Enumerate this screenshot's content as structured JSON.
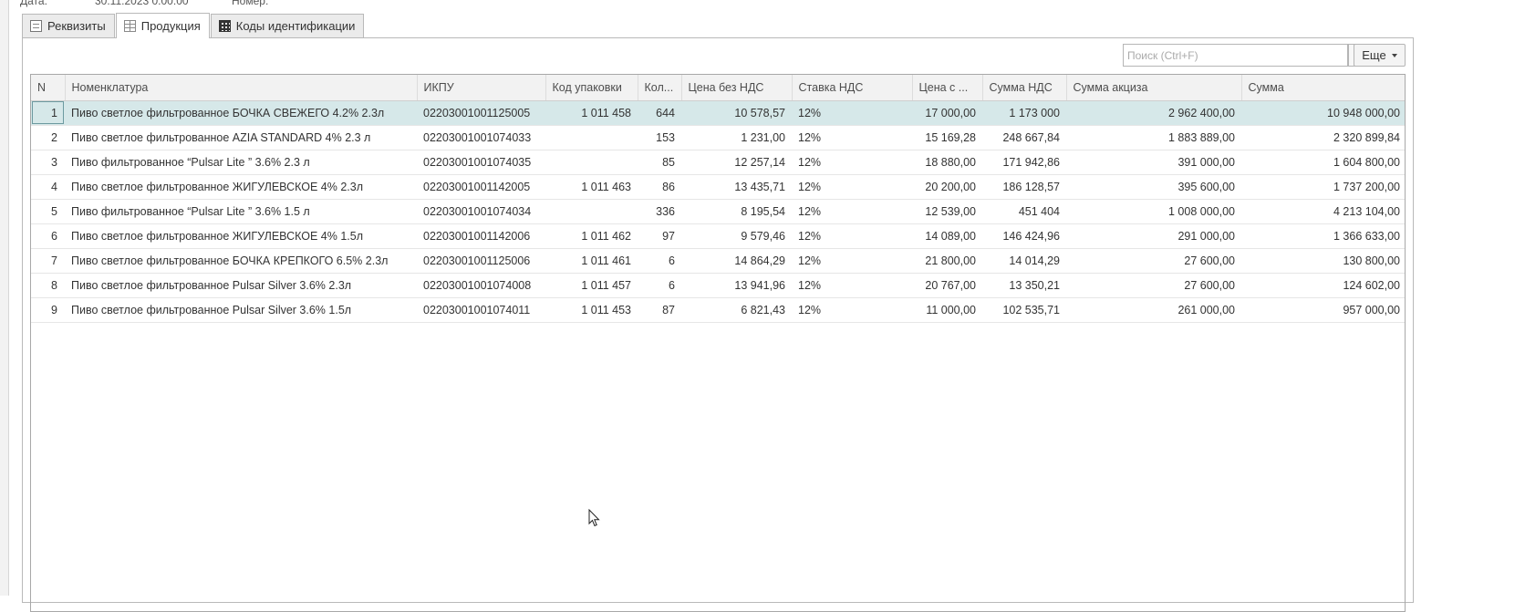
{
  "header_cut": {
    "left_label": "Дата:",
    "date_value": "30.11.2023 0:00:00",
    "number_label": "Номер:"
  },
  "tabs": [
    {
      "label": "Реквизиты",
      "icon": "document-icon",
      "active": false
    },
    {
      "label": "Продукция",
      "icon": "table-icon",
      "active": true
    },
    {
      "label": "Коды идентификации",
      "icon": "qr-code-icon",
      "active": false
    }
  ],
  "toolbar": {
    "search_placeholder": "Поиск (Ctrl+F)",
    "clear_label": "×",
    "more_label": "Еще"
  },
  "columns": [
    "N",
    "Номенклатура",
    "ИКПУ",
    "Код упаковки",
    "Кол...",
    "Цена без НДС",
    "Ставка НДС",
    "Цена с ...",
    "Сумма НДС",
    "Сумма акциза",
    "Сумма"
  ],
  "rows": [
    [
      "1",
      "Пиво светлое фильтрованное БОЧКА СВЕЖЕГО 4.2% 2.3л",
      "02203001001125005",
      "1 011 458",
      "644",
      "10 578,57",
      "12%",
      "17 000,00",
      "1 173 000",
      "2 962 400,00",
      "10 948 000,00"
    ],
    [
      "2",
      "Пиво светлое фильтрованное AZIA STANDARD 4% 2.3 л",
      "02203001001074033",
      "",
      "153",
      "1 231,00",
      "12%",
      "15 169,28",
      "248 667,84",
      "1 883 889,00",
      "2 320 899,84"
    ],
    [
      "3",
      "Пиво фильтрованное “Pulsar Lite ” 3.6% 2.3 л",
      "02203001001074035",
      "",
      "85",
      "12 257,14",
      "12%",
      "18 880,00",
      "171 942,86",
      "391 000,00",
      "1 604 800,00"
    ],
    [
      "4",
      "Пиво светлое фильтрованное ЖИГУЛЕВСКОЕ 4% 2.3л",
      "02203001001142005",
      "1 011 463",
      "86",
      "13 435,71",
      "12%",
      "20 200,00",
      "186 128,57",
      "395 600,00",
      "1 737 200,00"
    ],
    [
      "5",
      "Пиво фильтрованное “Pulsar Lite ” 3.6% 1.5 л",
      "02203001001074034",
      "",
      "336",
      "8 195,54",
      "12%",
      "12 539,00",
      "451 404",
      "1 008 000,00",
      "4 213 104,00"
    ],
    [
      "6",
      "Пиво светлое фильтрованное ЖИГУЛЕВСКОЕ 4% 1.5л",
      "02203001001142006",
      "1 011 462",
      "97",
      "9 579,46",
      "12%",
      "14 089,00",
      "146 424,96",
      "291 000,00",
      "1 366 633,00"
    ],
    [
      "7",
      "Пиво светлое фильтрованное БОЧКА КРЕПКОГО  6.5% 2.3л",
      "02203001001125006",
      "1 011 461",
      "6",
      "14 864,29",
      "12%",
      "21 800,00",
      "14 014,29",
      "27 600,00",
      "130 800,00"
    ],
    [
      "8",
      "Пиво светлое фильтрованное Pulsar Silver 3.6% 2.3л",
      "02203001001074008",
      "1 011 457",
      "6",
      "13 941,96",
      "12%",
      "20 767,00",
      "13 350,21",
      "27 600,00",
      "124 602,00"
    ],
    [
      "9",
      "Пиво светлое фильтрованное Pulsar Silver 3.6% 1.5л",
      "02203001001074011",
      "1 011 453",
      "87",
      "6 821,43",
      "12%",
      "11 000,00",
      "102 535,71",
      "261 000,00",
      "957 000,00"
    ]
  ],
  "colors": {
    "selected_row": "#d6e8e9",
    "header_bg": "#f2f2f2",
    "tab_inactive": "#ebebeb"
  }
}
